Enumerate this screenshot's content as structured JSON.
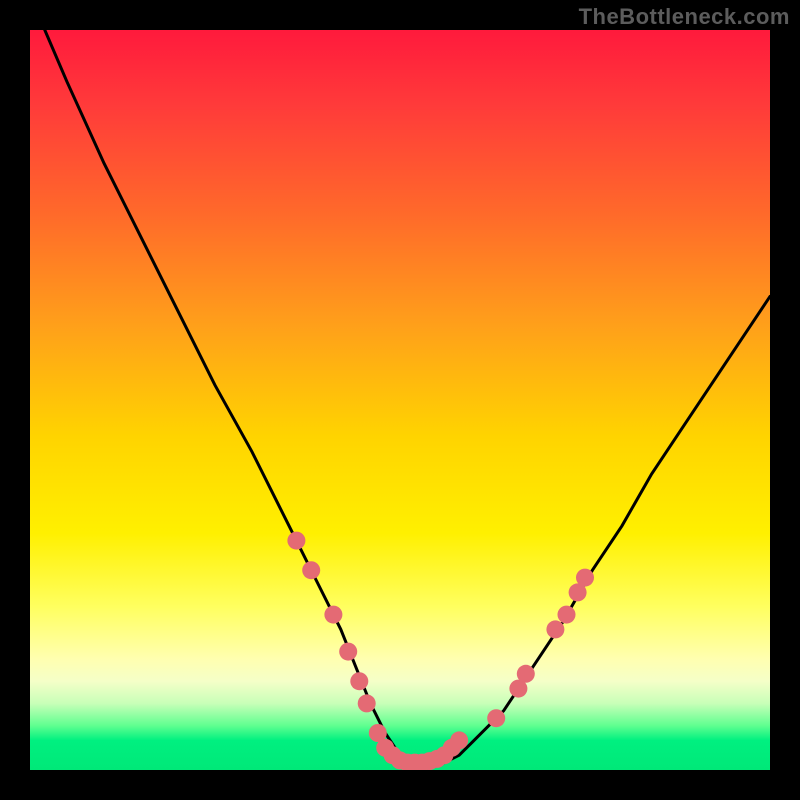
{
  "watermark": "TheBottleneck.com",
  "chart_data": {
    "type": "line",
    "title": "",
    "xlabel": "",
    "ylabel": "",
    "xlim": [
      0,
      100
    ],
    "ylim": [
      0,
      100
    ],
    "series": [
      {
        "name": "bottleneck-curve",
        "x": [
          2,
          5,
          10,
          15,
          20,
          25,
          30,
          33,
          36,
          39,
          42,
          44,
          46,
          48,
          50,
          52,
          54,
          56,
          58,
          60,
          64,
          68,
          72,
          76,
          80,
          84,
          88,
          92,
          96,
          100
        ],
        "y": [
          100,
          93,
          82,
          72,
          62,
          52,
          43,
          37,
          31,
          25,
          19,
          14,
          9,
          5,
          2,
          1,
          1,
          1,
          2,
          4,
          8,
          14,
          20,
          27,
          33,
          40,
          46,
          52,
          58,
          64
        ]
      }
    ],
    "markers": {
      "name": "marker-points",
      "color": "#e46a74",
      "points": [
        {
          "x": 36,
          "y": 31
        },
        {
          "x": 38,
          "y": 27
        },
        {
          "x": 41,
          "y": 21
        },
        {
          "x": 43,
          "y": 16
        },
        {
          "x": 44.5,
          "y": 12
        },
        {
          "x": 45.5,
          "y": 9
        },
        {
          "x": 47,
          "y": 5
        },
        {
          "x": 48,
          "y": 3
        },
        {
          "x": 49,
          "y": 2
        },
        {
          "x": 50,
          "y": 1.3
        },
        {
          "x": 51,
          "y": 1
        },
        {
          "x": 52,
          "y": 1
        },
        {
          "x": 53,
          "y": 1
        },
        {
          "x": 54,
          "y": 1.2
        },
        {
          "x": 55,
          "y": 1.5
        },
        {
          "x": 56,
          "y": 2
        },
        {
          "x": 57,
          "y": 3
        },
        {
          "x": 58,
          "y": 4
        },
        {
          "x": 63,
          "y": 7
        },
        {
          "x": 66,
          "y": 11
        },
        {
          "x": 67,
          "y": 13
        },
        {
          "x": 71,
          "y": 19
        },
        {
          "x": 72.5,
          "y": 21
        },
        {
          "x": 74,
          "y": 24
        },
        {
          "x": 75,
          "y": 26
        }
      ]
    },
    "gradient_stops": [
      {
        "pos": 0,
        "color": "#ff1a3c"
      },
      {
        "pos": 50,
        "color": "#ffd400"
      },
      {
        "pos": 85,
        "color": "#ffffb0"
      },
      {
        "pos": 100,
        "color": "#00e878"
      }
    ]
  }
}
